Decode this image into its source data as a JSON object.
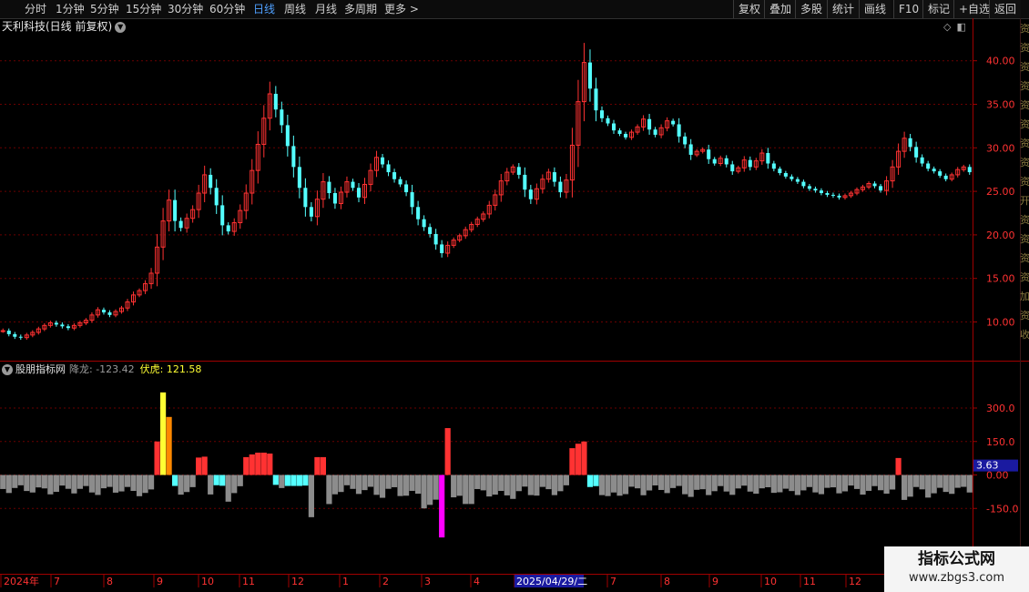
{
  "toolbar": {
    "timeframes": [
      "分时",
      "1分钟",
      "5分钟",
      "15分钟",
      "30分钟",
      "60分钟",
      "日线",
      "周线",
      "月线",
      "多周期",
      "更多 >"
    ],
    "active": "日线",
    "right_buttons": [
      "复权",
      "叠加",
      "多股",
      "统计",
      "画线",
      "F10",
      "标记",
      "+自选",
      "返回"
    ]
  },
  "stock": {
    "title": "天利科技(日线 前复权)",
    "dropdown_icon": "chevron-down-icon"
  },
  "indicator": {
    "name": "股朋指标网",
    "label1": "降龙: -123.42",
    "label2": "伏虎: 121.58"
  },
  "price_axis": {
    "ticks": [
      "40.00",
      "35.00",
      "30.00",
      "25.00",
      "20.00",
      "15.00",
      "10.00"
    ]
  },
  "indicator_axis": {
    "ticks": [
      "300.0",
      "150.0",
      "0.00",
      "-150.0"
    ],
    "current_value": "3.63"
  },
  "date_axis": {
    "labels": [
      "2024年",
      "7",
      "8",
      "9",
      "10",
      "11",
      "12",
      "1",
      "2",
      "3",
      "4",
      "2025/04/29/二",
      "7",
      "8",
      "9",
      "10",
      "11",
      "12"
    ],
    "highlighted": "2025/04/29/二"
  },
  "right_strip_chars": [
    "资",
    "资",
    "资",
    "资",
    "资",
    "资",
    "资",
    "资",
    "资",
    "开",
    "资",
    "资",
    "资",
    "资",
    "加",
    "资",
    "收"
  ],
  "colors": {
    "up": "#ff3232",
    "down": "#54ffff",
    "grid": "#6a0000",
    "axis": "#a00000",
    "gray_bar": "#8c8c8c",
    "yellow_bar": "#ffff33",
    "orange_bar": "#ff8800",
    "magenta_bar": "#ff00ff",
    "label_box": "#1a1aa0"
  },
  "chart_data": [
    {
      "type": "candlestick",
      "title": "天利科技(日线 前复权)",
      "ylim": [
        7,
        43
      ],
      "close_series": [
        9.0,
        8.6,
        8.3,
        8.2,
        8.5,
        8.8,
        9.2,
        9.6,
        9.9,
        9.7,
        9.5,
        9.3,
        9.6,
        9.9,
        10.2,
        10.8,
        11.4,
        11.1,
        10.8,
        11.2,
        11.6,
        12.3,
        13.1,
        13.6,
        14.4,
        15.6,
        18.6,
        21.6,
        24.0,
        21.6,
        20.8,
        21.9,
        22.9,
        24.8,
        26.9,
        25.4,
        23.4,
        21.1,
        20.4,
        21.4,
        22.8,
        24.8,
        27.4,
        30.4,
        33.4,
        36.2,
        34.4,
        32.6,
        30.2,
        27.8,
        25.4,
        23.2,
        22.1,
        24.1,
        26.1,
        24.8,
        23.6,
        24.9,
        26.1,
        25.4,
        24.3,
        25.8,
        27.4,
        28.9,
        28.1,
        27.2,
        26.4,
        25.8,
        24.9,
        23.2,
        21.8,
        20.9,
        20.1,
        18.9,
        17.9,
        18.8,
        19.4,
        19.9,
        20.6,
        21.2,
        21.8,
        22.4,
        23.4,
        24.6,
        26.2,
        27.2,
        27.8,
        26.9,
        25.2,
        24.1,
        25.3,
        26.4,
        27.2,
        26.1,
        24.9,
        26.3,
        30.3,
        35.3,
        39.8,
        36.8,
        34.3,
        33.4,
        32.8,
        32.0,
        31.6,
        31.2,
        31.8,
        32.4,
        33.3,
        32.1,
        31.5,
        32.3,
        33.1,
        32.7,
        31.3,
        30.4,
        29.2,
        29.6,
        29.8,
        28.7,
        28.2,
        28.8,
        28.1,
        27.3,
        27.7,
        28.6,
        27.8,
        28.5,
        29.4,
        28.2,
        27.6,
        27.1,
        26.7,
        26.4,
        26.1,
        25.6,
        25.3,
        25.1,
        24.8,
        24.6,
        24.5,
        24.3,
        24.5,
        24.8,
        25.2,
        25.5,
        25.9,
        25.6,
        25.1,
        26.2,
        27.8,
        29.6,
        31.1,
        30.1,
        28.9,
        28.2,
        27.6,
        27.3,
        26.8,
        26.4,
        26.9,
        27.5,
        27.8,
        27.2
      ],
      "indicator_series": {
        "names": [
          "降龙",
          "伏虎"
        ],
        "last_values": [
          -123.42,
          121.58
        ],
        "current": 3.63,
        "peaks": [
          {
            "date": "2024-10",
            "value": 370
          },
          {
            "date": "2025-04",
            "value": 170
          },
          {
            "date": "2025-04",
            "value": -280
          },
          {
            "date": "2025-07",
            "value": 120
          }
        ]
      }
    }
  ]
}
